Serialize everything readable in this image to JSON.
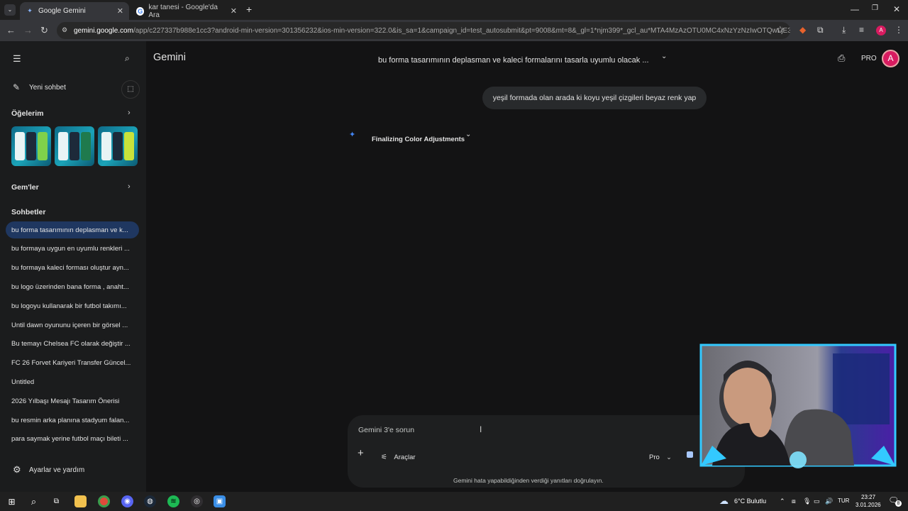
{
  "browser": {
    "tabs": [
      {
        "title": "Google Gemini",
        "active": true,
        "favicon": "gemini-sparkle-icon"
      },
      {
        "title": "kar tanesi - Google'da Ara",
        "active": false,
        "favicon": "google-icon"
      }
    ],
    "url_host": "gemini.google.com",
    "url_rest": "/app/c227337b988e1cc3?android-min-version=301356232&ios-min-version=322.0&is_sa=1&campaign_id=test_autosubmit&pt=9008&mt=8&_gl=1*njm399*_gcl_au*MTA4MzAzOTU0MC4xNzYzNzIwOTQwLjE3MDM5...",
    "profile_letter": "A"
  },
  "sidebar": {
    "new_chat": "Yeni sohbet",
    "my_items": "Öğelerim",
    "gems": "Gem'ler",
    "chats_heading": "Sohbetler",
    "chats": [
      "bu forma tasarımının deplasman ve k...",
      "bu formaya uygun en uyumlu renkleri ...",
      "bu formaya kaleci forması oluştur ayn...",
      "bu logo üzerinden bana forma , anaht...",
      "bu logoyu kullanarak bir futbol takımı...",
      "Until dawn oyununu içeren bir görsel ...",
      "Bu temayı Chelsea FC olarak değiştir ...",
      "FC 26 Forvet Kariyeri Transfer Güncel...",
      "Untitled",
      "2026 Yılbaşı Mesajı Tasarım Önerisi",
      "bu resmin arka planına stadyum falan...",
      "para saymak yerine futbol maçı bileti ..."
    ],
    "settings": "Ayarlar ve yardım"
  },
  "header": {
    "app_name": "Gemini",
    "conversation_title": "bu forma tasarımının deplasman ve kaleci formalarını tasarla uyumlu olacak ...",
    "plan_badge": "PRO",
    "avatar_letter": "A"
  },
  "conversation": {
    "user_message": "yeşil formada olan arada ki koyu yeşil çizgileri beyaz renk yap",
    "thinking_status": "Finalizing Color Adjustments"
  },
  "composer": {
    "placeholder": "Gemini 3'e sorun",
    "tools_label": "Araçlar",
    "model_label": "Pro"
  },
  "footer_disclaimer": "Gemini hata yapabildiğinden verdiği yanıtları doğrulayın.",
  "taskbar": {
    "weather": "6°C  Bulutlu",
    "language": "TUR",
    "time": "23:27",
    "date": "3.01.2026",
    "notification_count": "8"
  },
  "colors": {
    "background": "#131314",
    "sidebar": "#1b1c1d",
    "active_chat": "#1f3760",
    "accent": "#4285f4",
    "avatar": "#d81b60"
  }
}
